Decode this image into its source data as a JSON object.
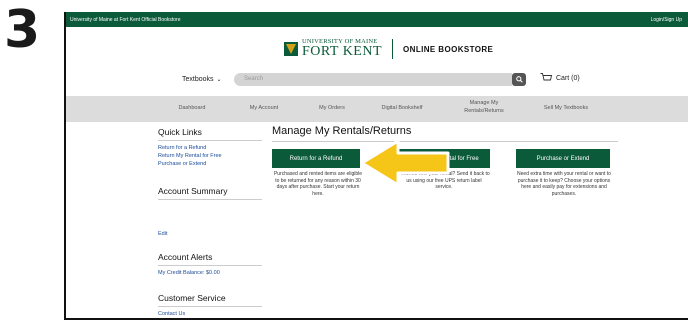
{
  "step": "3",
  "topbar": {
    "site_name": "University of Maine at Fort Kent Official Bookstore",
    "login": "Login/Sign Up"
  },
  "brand": {
    "line1": "UNIVERSITY OF MAINE",
    "line2": "FORT KENT",
    "store": "ONLINE BOOKSTORE"
  },
  "header": {
    "shop_menu": "Textbooks",
    "search_placeholder": "Search",
    "cart": "Cart (0)"
  },
  "nav": [
    "Dashboard",
    "My Account",
    "My Orders",
    "Digital Bookshelf",
    "Manage My\nRentals/Returns",
    "Sell My Textbooks"
  ],
  "sidebar": {
    "quick_links_title": "Quick Links",
    "quick_links": [
      "Return for a Refund",
      "Return My Rental for Free",
      "Purchase or Extend"
    ],
    "account_summary_title": "Account Summary",
    "edit": "Edit",
    "account_alerts_title": "Account Alerts",
    "credit_balance": "My Credit Balance: $0.00",
    "customer_service_title": "Customer Service",
    "contact_us": "Contact Us"
  },
  "main": {
    "title": "Manage My Rentals/Returns",
    "actions": [
      {
        "label": "Return for a Refund",
        "desc": "Purchased and rented items are eligible to be returned for any reason within 30 days after purchase. Start your return here."
      },
      {
        "label": "Return My Rental for Free",
        "desc": "Finished with your rental? Send it back to us using our free UPS return label service."
      },
      {
        "label": "Purchase or Extend",
        "desc": "Need extra time with your rental or want to purchase it to keep? Choose your options here and easily pay for extensions and purchases."
      }
    ]
  },
  "colors": {
    "brand_green": "#0b5a3a",
    "arrow_yellow": "#f5c518"
  }
}
